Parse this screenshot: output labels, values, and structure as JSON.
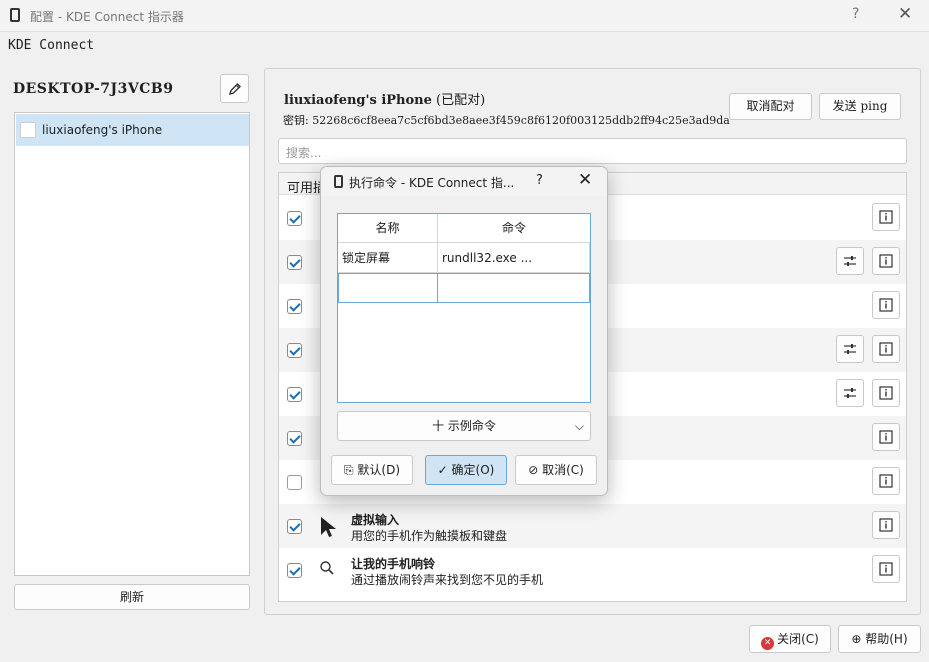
{
  "window": {
    "title": "配置 - KDE Connect 指示器",
    "help": "?",
    "close": "✕"
  },
  "app_label": "KDE Connect",
  "left": {
    "device_name": "DESKTOP-7J3VCB9",
    "devices": [
      {
        "label": "liuxiaofeng's iPhone"
      }
    ],
    "refresh": "刷新"
  },
  "right": {
    "device_title": "liuxiaofeng's iPhone",
    "paired_status": "(已配对)",
    "key": "密钥: 52268c6cf8eea7c5cf6bd3e8aee3f459c8f6120f003125ddb2ff94c25e3ad9da",
    "unpair": "取消配对",
    "send_ping": "发送 ping",
    "search_placeholder": "搜索...",
    "plugins_header": "可用插件",
    "plugins": [
      {
        "checked": true,
        "name": "",
        "desc": "",
        "config": false
      },
      {
        "checked": true,
        "name": "",
        "desc": "",
        "config": true
      },
      {
        "checked": true,
        "name": "",
        "desc": "",
        "config": false
      },
      {
        "checked": true,
        "name": "",
        "desc": "",
        "config": true
      },
      {
        "checked": true,
        "name": "",
        "desc": "",
        "config": true
      },
      {
        "checked": true,
        "name": "",
        "desc": "",
        "config": false
      },
      {
        "checked": false,
        "name": "",
        "desc": "",
        "config": false
      },
      {
        "checked": true,
        "name": "虚拟输入",
        "desc": "用您的手机作为触摸板和键盘",
        "config": false,
        "icon": "cursor-icon"
      },
      {
        "checked": true,
        "name": "让我的手机响铃",
        "desc": "通过播放闹铃声来找到您不见的手机",
        "config": false,
        "icon": "search-icon"
      }
    ]
  },
  "footer": {
    "close": "关闭(C)",
    "help": "帮助(H)"
  },
  "dialog": {
    "title": "执行命令 - KDE Connect 指...",
    "help": "?",
    "close": "✕",
    "columns": [
      "名称",
      "命令"
    ],
    "rows": [
      {
        "name": "锁定屏幕",
        "command": "rundll32.exe ..."
      },
      {
        "name": "",
        "command": ""
      }
    ],
    "example_commands": "十 示例命令",
    "default_btn": "默认(D)",
    "ok_btn": "确定(O)",
    "cancel_btn": "取消(C)"
  }
}
